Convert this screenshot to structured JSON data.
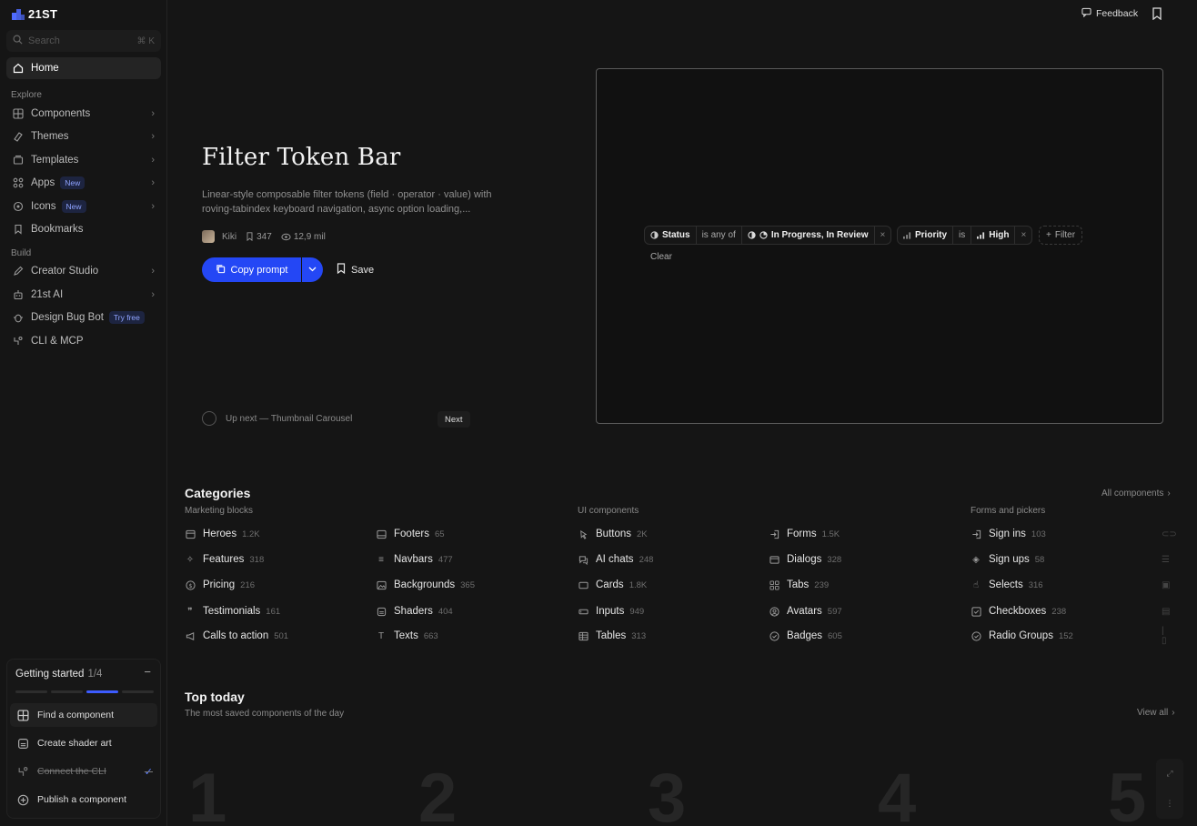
{
  "brand": {
    "name": "21ST"
  },
  "search": {
    "placeholder": "Search",
    "shortcut": "⌘ K"
  },
  "nav": {
    "home": "Home",
    "explore_label": "Explore",
    "explore": [
      {
        "label": "Components",
        "icon": "grid-icon"
      },
      {
        "label": "Themes",
        "icon": "palette-icon"
      },
      {
        "label": "Templates",
        "icon": "layers-icon"
      },
      {
        "label": "Apps",
        "icon": "apps-icon",
        "badge": "New"
      },
      {
        "label": "Icons",
        "icon": "shapes-icon",
        "badge": "New"
      },
      {
        "label": "Bookmarks",
        "icon": "bookmark-icon"
      }
    ],
    "build_label": "Build",
    "build": [
      {
        "label": "Creator Studio",
        "icon": "pen-icon"
      },
      {
        "label": "21st AI",
        "icon": "robot-icon"
      },
      {
        "label": "Design Bug Bot",
        "icon": "bug-icon",
        "badge": "Try free"
      },
      {
        "label": "CLI & MCP",
        "icon": "terminal-icon"
      }
    ]
  },
  "getting_started": {
    "title": "Getting started",
    "count": "1/4",
    "progress": 0.25,
    "items": [
      {
        "label": "Find a component",
        "icon": "grid-icon",
        "active": true,
        "done": false
      },
      {
        "label": "Create shader art",
        "icon": "shader-icon",
        "active": false,
        "done": false
      },
      {
        "label": "Connect the CLI",
        "icon": "terminal-icon",
        "active": false,
        "done": true
      },
      {
        "label": "Publish a component",
        "icon": "plus-circle-icon",
        "active": false,
        "done": false
      }
    ]
  },
  "header": {
    "feedback": "Feedback"
  },
  "hero": {
    "title": "Filter Token Bar",
    "description": "Linear-style composable filter tokens (field · operator · value) with roving-tabindex keyboard navigation, async option loading,...",
    "author": "Kiki",
    "bookmarks": "347",
    "views": "12,9 mil",
    "copy_label": "Copy prompt",
    "save_label": "Save",
    "up_next": "Up next — Thumbnail Carousel",
    "next_label": "Next"
  },
  "preview": {
    "token1": {
      "field": "Status",
      "operator": "is any of",
      "value": "In Progress, In Review"
    },
    "token2": {
      "field": "Priority",
      "operator": "is",
      "value": "High"
    },
    "add_filter": "Filter",
    "clear": "Clear"
  },
  "categories": {
    "title": "Categories",
    "all_link": "All components",
    "groups": [
      {
        "label": "Marketing blocks"
      },
      {
        "label": "UI components"
      },
      {
        "label": "Forms and pickers"
      }
    ],
    "col1": [
      {
        "label": "Heroes",
        "count": "1.2K"
      },
      {
        "label": "Features",
        "count": "318"
      },
      {
        "label": "Pricing",
        "count": "216"
      },
      {
        "label": "Testimonials",
        "count": "161"
      },
      {
        "label": "Calls to action",
        "count": "501"
      }
    ],
    "col2": [
      {
        "label": "Footers",
        "count": "65"
      },
      {
        "label": "Navbars",
        "count": "477"
      },
      {
        "label": "Backgrounds",
        "count": "365"
      },
      {
        "label": "Shaders",
        "count": "404"
      },
      {
        "label": "Texts",
        "count": "663"
      }
    ],
    "col3": [
      {
        "label": "Buttons",
        "count": "2K"
      },
      {
        "label": "AI chats",
        "count": "248"
      },
      {
        "label": "Cards",
        "count": "1.8K"
      },
      {
        "label": "Inputs",
        "count": "949"
      },
      {
        "label": "Tables",
        "count": "313"
      }
    ],
    "col4": [
      {
        "label": "Forms",
        "count": "1.5K"
      },
      {
        "label": "Dialogs",
        "count": "328"
      },
      {
        "label": "Tabs",
        "count": "239"
      },
      {
        "label": "Avatars",
        "count": "597"
      },
      {
        "label": "Badges",
        "count": "605"
      }
    ],
    "col5": [
      {
        "label": "Sign ins",
        "count": "103"
      },
      {
        "label": "Sign ups",
        "count": "58"
      },
      {
        "label": "Selects",
        "count": "316"
      },
      {
        "label": "Checkboxes",
        "count": "238"
      },
      {
        "label": "Radio Groups",
        "count": "152"
      }
    ]
  },
  "top_today": {
    "title": "Top today",
    "subtitle": "The most saved components of the day",
    "view_all": "View all",
    "ranks": [
      "1",
      "2",
      "3",
      "4",
      "5"
    ]
  },
  "colors": {
    "accent": "#2447f5",
    "background": "#151515"
  }
}
